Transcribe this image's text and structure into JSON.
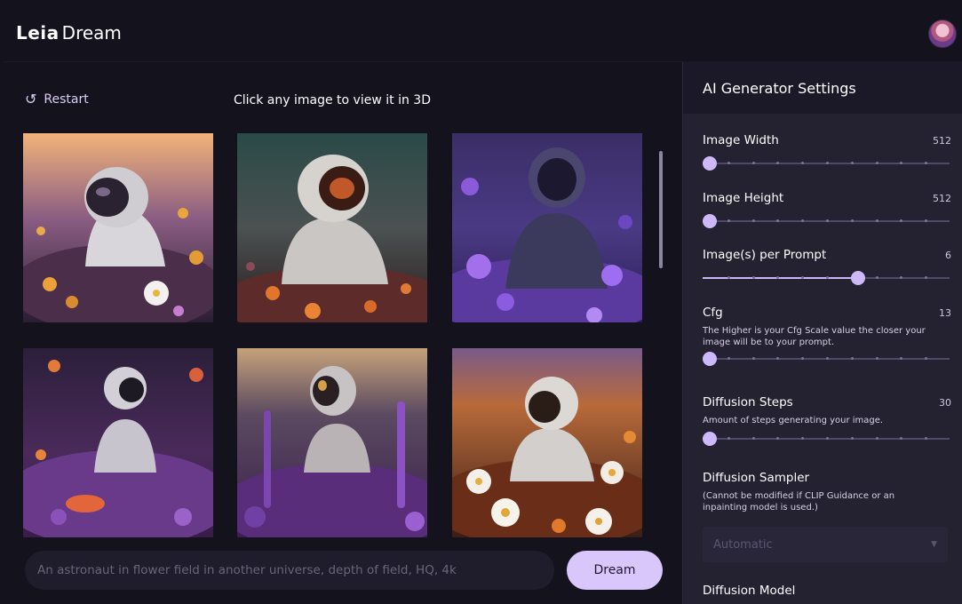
{
  "header": {
    "brand": "Leia",
    "product": "Dream"
  },
  "main": {
    "restart_label": "Restart",
    "hint": "Click any image to view it in 3D",
    "prompt_value": "",
    "prompt_placeholder": "An astronaut in flower field in another universe, depth of field, HQ, 4k",
    "dream_label": "Dream"
  },
  "panel": {
    "title": "AI Generator Settings",
    "settings": [
      {
        "label": "Image Width",
        "value": "512",
        "fraction": 0.03
      },
      {
        "label": "Image Height",
        "value": "512",
        "fraction": 0.03
      },
      {
        "label": "Image(s) per Prompt",
        "value": "6",
        "fraction": 0.63
      },
      {
        "label": "Cfg",
        "value": "13",
        "description": "The Higher is your Cfg Scale value the closer your image will be to your prompt.",
        "fraction": 0.03
      },
      {
        "label": "Diffusion Steps",
        "value": "30",
        "description": "Amount of steps generating your image.",
        "fraction": 0.03
      }
    ],
    "sampler": {
      "label": "Diffusion Sampler",
      "description": "(Cannot be modified if CLIP Guidance or an inpainting model is used.)",
      "selected": "Automatic"
    },
    "model_label": "Diffusion Model"
  },
  "colors": {
    "accent": "#cdb8fa",
    "background": "#14121d",
    "panel": "#242131",
    "button": "#d9c6fb"
  },
  "icons": {
    "restart": "restart-icon",
    "avatar": "user-avatar",
    "caret": "chevron-down-icon"
  }
}
